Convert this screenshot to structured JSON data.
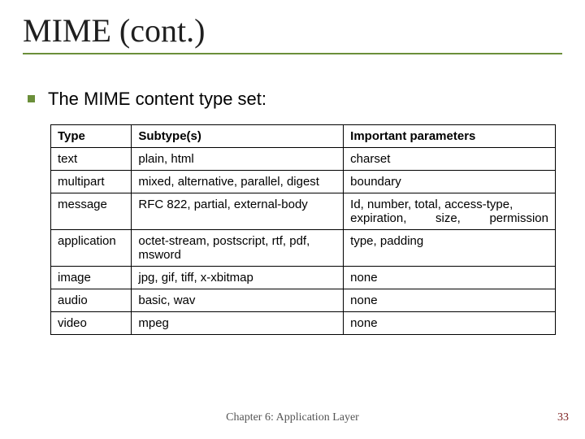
{
  "title": "MIME (cont.)",
  "bullet_text": "The MIME content type set:",
  "table": {
    "headers": {
      "type": "Type",
      "subtypes": "Subtype(s)",
      "params": "Important parameters"
    },
    "rows": [
      {
        "type": "text",
        "subtypes": "plain, html",
        "params": "charset"
      },
      {
        "type": "multipart",
        "subtypes": "mixed, alternative, parallel, digest",
        "params": "boundary"
      },
      {
        "type": "message",
        "subtypes": "RFC 822, partial, external-body",
        "params": "Id, number, total, access-type, expiration, size, permission"
      },
      {
        "type": "application",
        "subtypes": "octet-stream, postscript, rtf, pdf, msword",
        "params": "type, padding"
      },
      {
        "type": "image",
        "subtypes": "jpg, gif, tiff, x-xbitmap",
        "params": "none"
      },
      {
        "type": "audio",
        "subtypes": "basic, wav",
        "params": "none"
      },
      {
        "type": "video",
        "subtypes": "mpeg",
        "params": "none"
      }
    ]
  },
  "footer": {
    "chapter": "Chapter 6: Application Layer",
    "page": "33"
  }
}
